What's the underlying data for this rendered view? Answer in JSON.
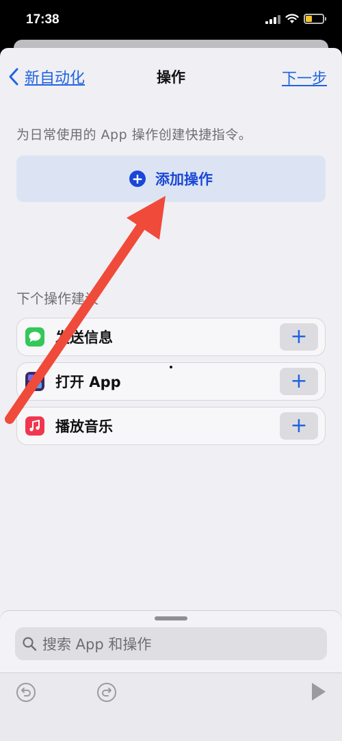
{
  "status_bar": {
    "time": "17:38"
  },
  "nav": {
    "back_label": "新自动化",
    "title": "操作",
    "next_label": "下一步"
  },
  "subtitle": "为日常使用的 App 操作创建快捷指令。",
  "add_action_label": "添加操作",
  "suggestions": {
    "title": "下个操作建议",
    "items": [
      {
        "label": "发送信息",
        "icon": "messages-icon"
      },
      {
        "label": "打开 App",
        "icon": "app-grid-icon"
      },
      {
        "label": "播放音乐",
        "icon": "music-icon"
      }
    ]
  },
  "search": {
    "placeholder": "搜索 App 和操作"
  },
  "colors": {
    "accent": "#1f63e0",
    "add_button_bg": "#dce4f4",
    "arrow": "#f04a3a"
  }
}
